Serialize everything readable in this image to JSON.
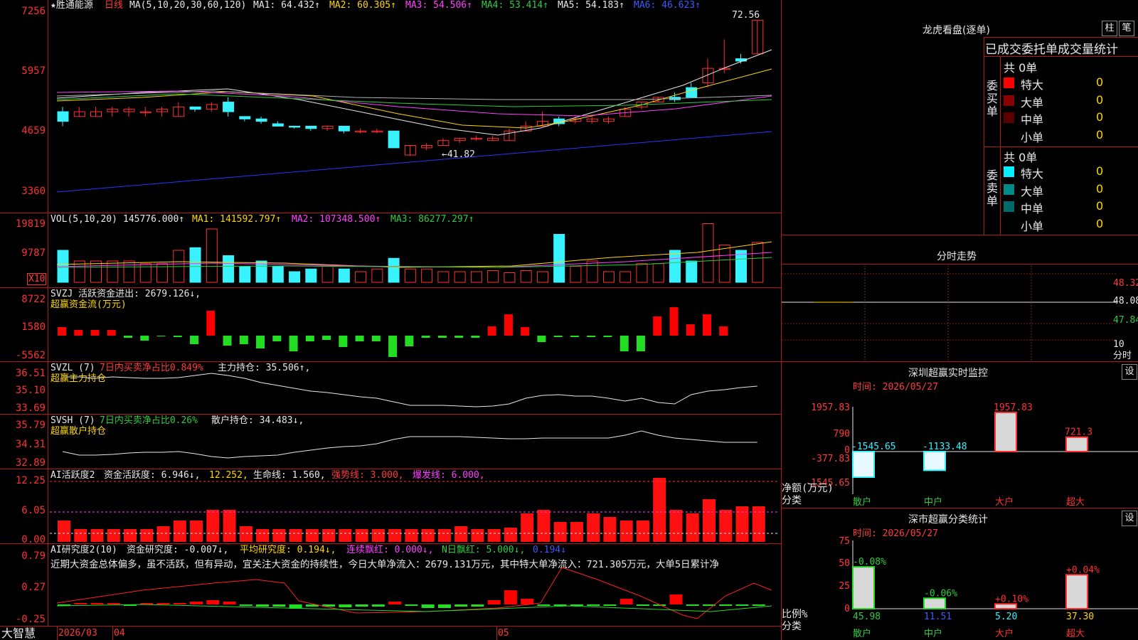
{
  "stock": {
    "title": "★胜通能源",
    "period": "日线"
  },
  "price_panel": {
    "ma_header": "MA(5,10,20,30,60,120)",
    "ma1": "MA1: 64.432↑",
    "ma2": "MA2: 60.305↑",
    "ma3": "MA3: 54.506↑",
    "ma4": "MA4: 53.414↑",
    "ma5": "MA5: 54.183↑",
    "ma6": "MA6: 46.623↑",
    "axis": [
      "7256",
      "5957",
      "4659",
      "3360"
    ],
    "high_label": "72.56",
    "low_label": "←41.82"
  },
  "vol_panel": {
    "header": "VOL(5,10,20)",
    "value": "145776.000↑",
    "ma1": "MA1: 141592.797↑",
    "ma2": "MA2: 107348.500↑",
    "ma3": "MA3: 86277.297↑",
    "axis": [
      "19819",
      "9787"
    ],
    "unit": "X10"
  },
  "svzj_panel": {
    "header": "SVZJ  活跃资金进出: 2679.126↓,",
    "subtitle": "超赢资金流(万元)",
    "axis": [
      "8722",
      "1580",
      "-5562"
    ]
  },
  "svzl_panel": {
    "header1": "SVZL (7)",
    "header2": "7日内买卖净占比0.849%",
    "header3": "主力持仓: 35.506↑,",
    "subtitle": "超赢主力持仓",
    "axis": [
      "36.51",
      "35.10",
      "33.69"
    ]
  },
  "svsh_panel": {
    "header1": "SVSH (7)",
    "header2": "7日内买卖净占比0.26%",
    "header3": "散户持仓: 34.483↓,",
    "subtitle": "超赢散户持仓",
    "axis": [
      "35.79",
      "34.31",
      "32.89"
    ]
  },
  "ai_panel": {
    "h1": "AI活跃度2",
    "h2": "资金活跃度: 6.946↓,",
    "h3": "12.252,",
    "h4": "生命线: 1.560,",
    "h5": "强势线: 3.000,",
    "h6": "爆发线: 6.000,",
    "axis": [
      "12.25",
      "6.05",
      "0.00"
    ]
  },
  "ai_research_panel": {
    "h1": "AI研究度2(10)",
    "h2": "资金研究度: -0.007↓,",
    "h3": "平均研究度: 0.194↓,",
    "h4": "连续飘红: 0.000↓,",
    "h5": "N日飘红: 5.000↓,",
    "h6": "0.194↓",
    "comment": "近期大资金总体偏多，虽不活跃，但有异动，宜关注大资金的持续性，今日大单净流入：2679.131万元，其中特大单净流入：721.305万元，大单5日累计净",
    "axis": [
      "0.79",
      "0.27",
      "-0.25"
    ]
  },
  "bottom_bar": {
    "brand": "大智慧",
    "d1": "2026/03",
    "d2": "04",
    "d3": "05"
  },
  "dragon_tiger": {
    "title": "龙虎看盘(逐单)",
    "btn1": "柱",
    "btn2": "笔",
    "tabs": "已成交委托单成交量统计",
    "buy_label": "委买单",
    "sell_label": "委卖单",
    "buy_total": "共 0单",
    "sell_total": "共 0单",
    "buy_rows": [
      {
        "name": "特大",
        "value": "0",
        "color": "#ff0000"
      },
      {
        "name": "大单",
        "value": "0",
        "color": "#8a0000"
      },
      {
        "name": "中单",
        "value": "0",
        "color": "#5a0000"
      },
      {
        "name": "小单",
        "value": "0",
        "color": ""
      }
    ],
    "sell_rows": [
      {
        "name": "特大",
        "value": "0",
        "color": "#00f0ff"
      },
      {
        "name": "大单",
        "value": "0",
        "color": "#008a8a"
      },
      {
        "name": "中单",
        "value": "0",
        "color": "#006a6a"
      },
      {
        "name": "小单",
        "value": "0",
        "color": ""
      }
    ]
  },
  "intraday": {
    "title": "分时走势",
    "axis": [
      "48.32",
      "48.08",
      "47.84"
    ],
    "footer1": "10",
    "footer2": "分时"
  },
  "sz_monitor": {
    "title": "深圳超赢实时监控",
    "btn": "设",
    "time": "时间: 2026/05/27",
    "axis": [
      "1957.83",
      "790",
      "0",
      "-377.83",
      "-1545.65"
    ],
    "ylabel1": "净额(万元)",
    "ylabel2": "分类",
    "cats": [
      "散户",
      "中户",
      "大户",
      "超大"
    ],
    "values": [
      -1545.65,
      -1133.48,
      1957.83,
      721.3
    ],
    "labels": [
      "-1545.65",
      "-1133.48",
      "1957.83",
      "721.3"
    ]
  },
  "sz_stats": {
    "title": "深市超赢分类统计",
    "btn": "设",
    "time": "时间: 2026/05/27",
    "axis": [
      "75",
      "50",
      "25",
      "0"
    ],
    "ylabel1": "比例%",
    "ylabel2": "分类",
    "cats": [
      "散户",
      "中户",
      "大户",
      "超大"
    ],
    "values": [
      45.98,
      11.51,
      5.2,
      37.3
    ],
    "values_text": [
      "45.98",
      "11.51",
      "5.20",
      "37.30"
    ],
    "changes": [
      "-0.08%",
      "-0.06%",
      "+0.10%",
      "+0.04%"
    ]
  },
  "chart_data": {
    "type": "bar",
    "title": "深圳超赢实时监控",
    "categories": [
      "散户",
      "中户",
      "大户",
      "超大"
    ],
    "values": [
      -1545.65,
      -1133.48,
      1957.83,
      721.3
    ],
    "ylabel": "净额(万元)",
    "ylim": [
      -1545.65,
      1957.83
    ]
  }
}
